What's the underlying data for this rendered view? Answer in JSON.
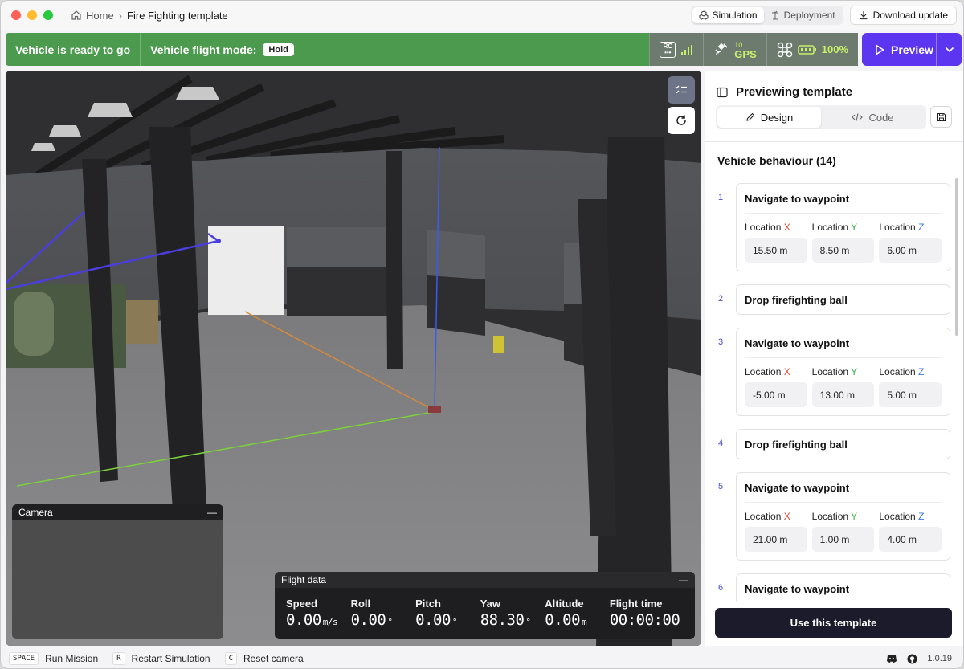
{
  "breadcrumb": {
    "home": "Home",
    "current": "Fire Fighting template"
  },
  "topbar": {
    "simulation": "Simulation",
    "deployment": "Deployment",
    "download": "Download update"
  },
  "status": {
    "ready": "Vehicle is ready to go",
    "mode_label": "Vehicle flight mode:",
    "mode_value": "Hold",
    "rc_label": "RC",
    "gps_count": "10",
    "gps_label": "GPS",
    "battery": "100%",
    "accent": "#c8f06a"
  },
  "preview": {
    "label": "Preview"
  },
  "camera": {
    "title": "Camera",
    "minimize": "—"
  },
  "flight": {
    "title": "Flight data",
    "minimize": "—",
    "items": [
      {
        "label": "Speed",
        "value": "0.00",
        "unit": "m/s"
      },
      {
        "label": "Roll",
        "value": "0.00",
        "unit": "°"
      },
      {
        "label": "Pitch",
        "value": "0.00",
        "unit": "°"
      },
      {
        "label": "Yaw",
        "value": "88.30",
        "unit": "°"
      },
      {
        "label": "Altitude",
        "value": "0.00",
        "unit": "m"
      },
      {
        "label": "Flight time",
        "value": "00:00:00",
        "unit": ""
      }
    ]
  },
  "panel": {
    "title": "Previewing template",
    "tab_design": "Design",
    "tab_code": "Code",
    "section": "Vehicle behaviour (14)",
    "loc_x": "Location",
    "loc_x_axis": "X",
    "loc_y_axis": "Y",
    "loc_z_axis": "Z",
    "use_button": "Use this template",
    "steps": [
      {
        "num": "1",
        "title": "Navigate to waypoint",
        "values": [
          "15.50 m",
          "8.50 m",
          "6.00 m"
        ]
      },
      {
        "num": "2",
        "title": "Drop firefighting ball"
      },
      {
        "num": "3",
        "title": "Navigate to waypoint",
        "values": [
          "-5.00 m",
          "13.00 m",
          "5.00 m"
        ]
      },
      {
        "num": "4",
        "title": "Drop firefighting ball"
      },
      {
        "num": "5",
        "title": "Navigate to waypoint",
        "values": [
          "21.00 m",
          "1.00 m",
          "4.00 m"
        ]
      },
      {
        "num": "6",
        "title": "Navigate to waypoint"
      }
    ]
  },
  "footer": {
    "key_space": "SPACE",
    "run": "Run Mission",
    "key_r": "R",
    "restart": "Restart Simulation",
    "key_c": "C",
    "reset": "Reset camera",
    "version": "1.0.19"
  }
}
